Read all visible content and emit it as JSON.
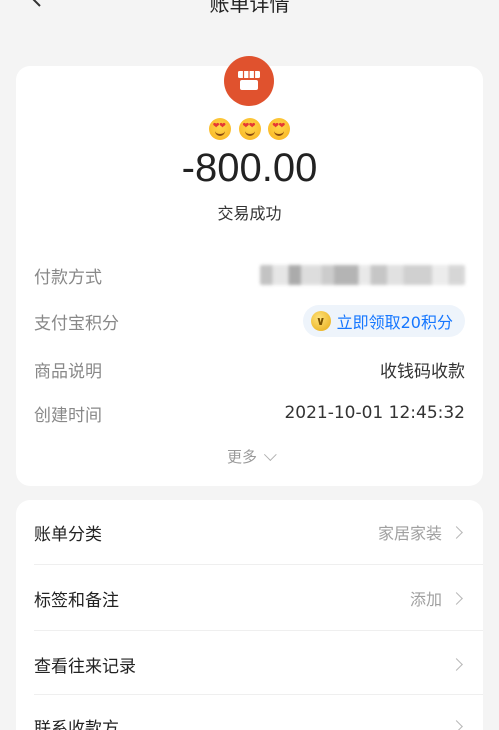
{
  "header": {
    "title": "账单详情"
  },
  "summary": {
    "shop_icon": "shop-icon",
    "emojis": [
      "heart-eyes-emoji",
      "heart-eyes-emoji",
      "heart-eyes-emoji"
    ],
    "amount": "-800.00",
    "status": "交易成功"
  },
  "details": {
    "payment_method_label": "付款方式",
    "alipay_points_label": "支付宝积分",
    "alipay_points_action": "立即领取20积分",
    "item_label": "商品说明",
    "item_value": "收钱码收款",
    "created_label": "创建时间",
    "created_value": "2021-10-01 12:45:32",
    "more_label": "更多"
  },
  "actions": {
    "category_label": "账单分类",
    "category_value": "家居家装",
    "tags_label": "标签和备注",
    "tags_value": "添加",
    "history_label": "查看往来记录",
    "contact_label": "联系收款方"
  },
  "colors": {
    "brand_orange": "#e0522e",
    "link_blue": "#1677ff",
    "background": "#f4f4f4"
  }
}
